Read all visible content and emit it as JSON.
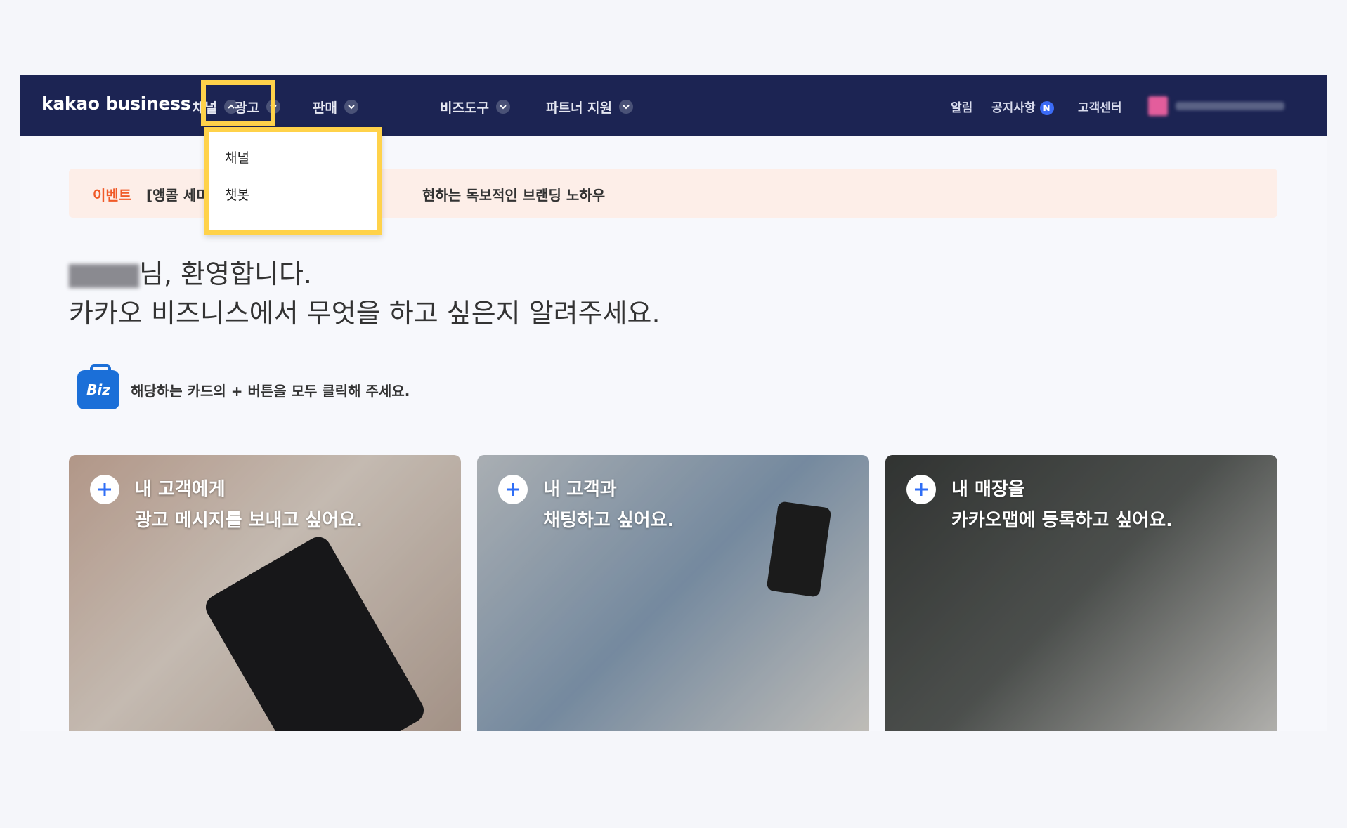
{
  "nav": {
    "logo": "kakao business",
    "menu": [
      {
        "label": "채널",
        "expanded": true
      },
      {
        "label": "광고"
      },
      {
        "label": "판매"
      },
      {
        "label": "비즈도구"
      },
      {
        "label": "파트너 지원"
      }
    ],
    "right": {
      "notifications": "알림",
      "notice": "공지사항",
      "notice_badge": "N",
      "support": "고객센터"
    }
  },
  "dropdown": {
    "items": [
      "채널",
      "챗봇"
    ]
  },
  "banner": {
    "tag": "이벤트",
    "text_left": "[앵콜 세미",
    "text_right": "현하는 독보적인 브랜딩 노하우"
  },
  "greeting": {
    "line1_suffix": "님, 환영합니다.",
    "line2": "카카오 비즈니스에서 무엇을 하고 싶은지 알려주세요."
  },
  "hint": {
    "icon_label": "Biz",
    "text": "해당하는 카드의 + 버튼을 모두 클릭해 주세요."
  },
  "cards": [
    {
      "line1": "내 고객에게",
      "line2": "광고 메시지를 보내고 싶어요."
    },
    {
      "line1": "내 고객과",
      "line2": "채팅하고 싶어요."
    },
    {
      "line1": "내 매장을",
      "line2": "카카오맵에 등록하고 싶어요."
    }
  ],
  "colors": {
    "nav_bg": "#1c2453",
    "highlight": "#ffd24a",
    "event_tag": "#f05a28",
    "plus_icon": "#2f6ef6"
  }
}
